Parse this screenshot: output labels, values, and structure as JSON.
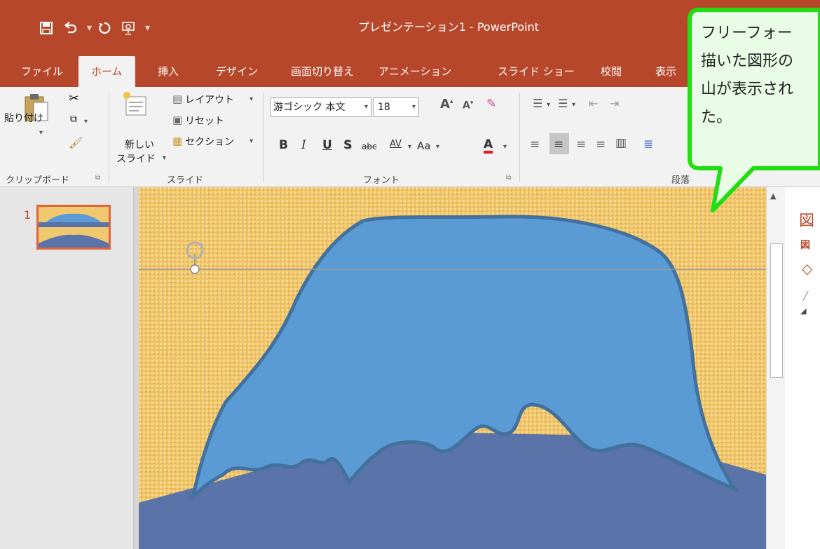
{
  "window": {
    "title": "プレゼンテーション1 - PowerPoint"
  },
  "tabs": [
    "ファイル",
    "ホーム",
    "挿入",
    "デザイン",
    "画面切り替え",
    "アニメーション",
    "スライド ショー",
    "校閲",
    "表示"
  ],
  "ribbon": {
    "clipboard": {
      "paste_label": "貼り付け",
      "group_label": "クリップボード"
    },
    "slides": {
      "new_slide_line1": "新しい",
      "new_slide_line2": "スライド",
      "layout": "レイアウト",
      "reset": "リセット",
      "section": "セクション",
      "group_label": "スライド"
    },
    "font": {
      "font_name": "游ゴシック 本文",
      "font_size": "18",
      "case_label": "Aa",
      "group_label": "フォント",
      "bold": "B",
      "italic": "I",
      "underline": "U",
      "shadow": "S",
      "strike": "abc",
      "spacing": "AV",
      "color_letter": "A"
    },
    "paragraph": {
      "group_label": "段落"
    }
  },
  "slides_pane": {
    "slide_number": "1"
  },
  "right_pane": {
    "title_char": "図",
    "sub_char": "図"
  },
  "callout": {
    "lines": [
      "フリーフォー",
      "描いた図形の",
      "山が表示され",
      "た。"
    ],
    "border_color": "#22dd11",
    "fill_color": "#e9fce6"
  },
  "colors": {
    "accent": "#b7472a",
    "shape_fill": "#5b9bd5",
    "shape_outline": "#41719c",
    "ground": "#5a73a8"
  }
}
